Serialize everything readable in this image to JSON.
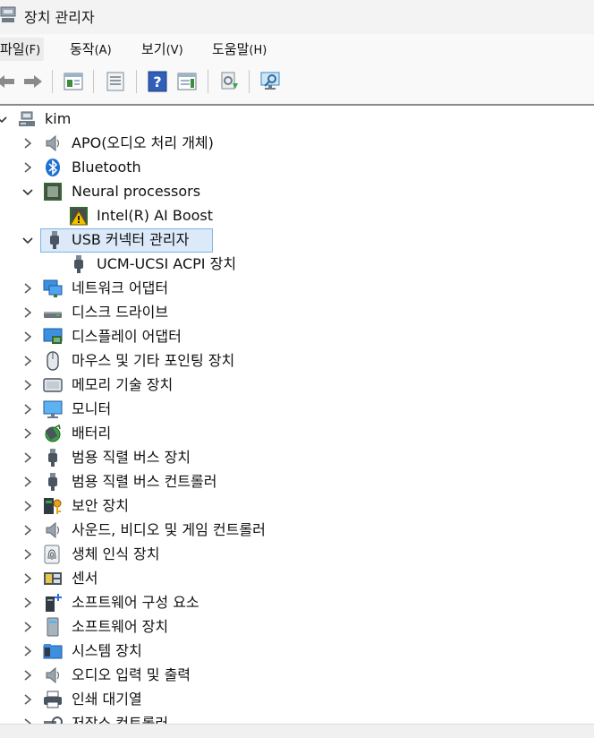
{
  "window": {
    "title": "장치 관리자"
  },
  "menu": [
    {
      "label": "파일",
      "accel": "(F)"
    },
    {
      "label": "동작",
      "accel": "(A)"
    },
    {
      "label": "보기",
      "accel": "(V)"
    },
    {
      "label": "도움말",
      "accel": "(H)"
    }
  ],
  "tree": {
    "root": "kim",
    "items": [
      {
        "label": "APO(오디오 처리 개체)",
        "icon": "speaker-icon",
        "expanded": false
      },
      {
        "label": "Bluetooth",
        "icon": "bluetooth-icon",
        "expanded": false
      },
      {
        "label": "Neural processors",
        "icon": "chip-icon",
        "expanded": true
      },
      {
        "label": "Intel(R) AI Boost",
        "icon": "chip-warning-icon",
        "child": true
      },
      {
        "label": "USB 커넥터 관리자",
        "icon": "usb-plug-icon",
        "expanded": true,
        "selected": true
      },
      {
        "label": "UCM-UCSI ACPI 장치",
        "icon": "usb-plug-icon",
        "child": true
      },
      {
        "label": "네트워크 어댑터",
        "icon": "network-icon",
        "expanded": false
      },
      {
        "label": "디스크 드라이브",
        "icon": "disk-icon",
        "expanded": false
      },
      {
        "label": "디스플레이 어댑터",
        "icon": "display-adapter-icon",
        "expanded": false
      },
      {
        "label": "마우스 및 기타 포인팅 장치",
        "icon": "mouse-icon",
        "expanded": false
      },
      {
        "label": "메모리 기술 장치",
        "icon": "memory-icon",
        "expanded": false
      },
      {
        "label": "모니터",
        "icon": "monitor-icon",
        "expanded": false
      },
      {
        "label": "배터리",
        "icon": "battery-icon",
        "expanded": false
      },
      {
        "label": "범용 직렬 버스 장치",
        "icon": "usb-plug-icon",
        "expanded": false
      },
      {
        "label": "범용 직렬 버스 컨트롤러",
        "icon": "usb-plug-icon",
        "expanded": false
      },
      {
        "label": "보안 장치",
        "icon": "security-key-icon",
        "expanded": false
      },
      {
        "label": "사운드, 비디오 및 게임 컨트롤러",
        "icon": "speaker-icon",
        "expanded": false
      },
      {
        "label": "생체 인식 장치",
        "icon": "fingerprint-icon",
        "expanded": false
      },
      {
        "label": "센서",
        "icon": "sensor-icon",
        "expanded": false
      },
      {
        "label": "소프트웨어 구성 요소",
        "icon": "software-component-icon",
        "expanded": false
      },
      {
        "label": "소프트웨어 장치",
        "icon": "software-device-icon",
        "expanded": false
      },
      {
        "label": "시스템 장치",
        "icon": "system-folder-icon",
        "expanded": false
      },
      {
        "label": "오디오 입력 및 출력",
        "icon": "speaker-icon",
        "expanded": false
      },
      {
        "label": "인쇄 대기열",
        "icon": "printer-icon",
        "expanded": false
      },
      {
        "label": "저장소 컨트롤러",
        "icon": "storage-controller-icon",
        "expanded": false
      }
    ]
  }
}
